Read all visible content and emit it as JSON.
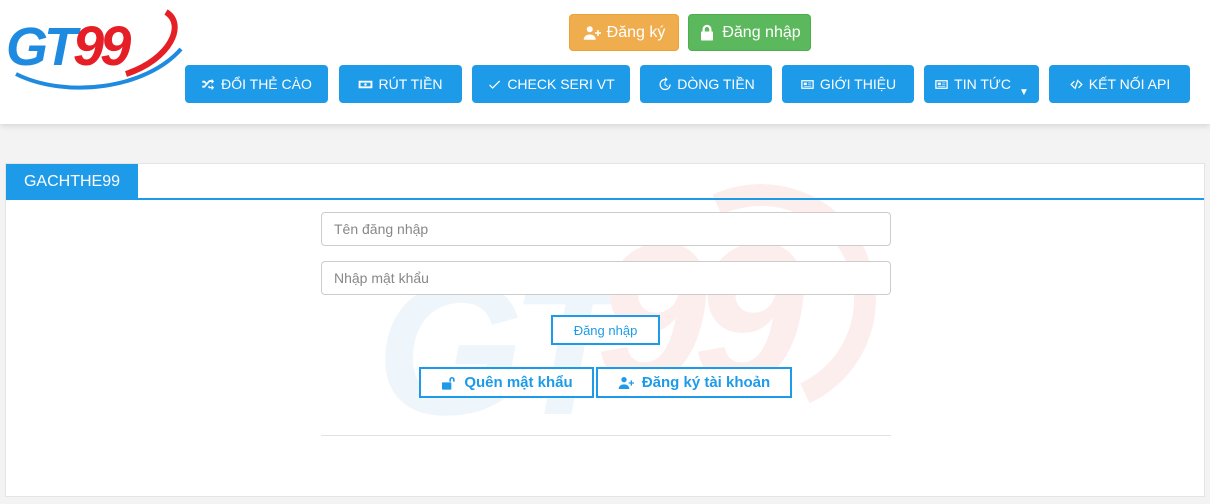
{
  "header": {
    "logo": {
      "text_gt": "GT",
      "text_99": "99"
    },
    "auth": {
      "register_label": "Đăng ký",
      "login_label": "Đăng nhập"
    },
    "nav": [
      {
        "label": "ĐỔI THẺ CÀO",
        "icon": "shuffle-icon"
      },
      {
        "label": "RÚT TIỀN",
        "icon": "money-icon"
      },
      {
        "label": "CHECK SERI VT",
        "icon": "check-icon"
      },
      {
        "label": "DÒNG TIỀN",
        "icon": "history-icon"
      },
      {
        "label": "GIỚI THIỆU",
        "icon": "newspaper-icon"
      },
      {
        "label": "TIN TỨC",
        "icon": "newspaper-icon",
        "has_dropdown": true
      },
      {
        "label": "KẾT NỐI API",
        "icon": "code-icon"
      }
    ]
  },
  "panel": {
    "tab_label": "GACHTHE99",
    "username_placeholder": "Tên đăng nhập",
    "password_placeholder": "Nhập mật khẩu",
    "submit_label": "Đăng nhập",
    "forgot_label": "Quên mật khẩu",
    "signup_label": "Đăng ký tài khoản"
  },
  "colors": {
    "primary": "#1e9be8",
    "warning": "#f0ad4e",
    "success": "#5cb85c",
    "logo_blue": "#1f8be0",
    "logo_red": "#e61e25"
  }
}
